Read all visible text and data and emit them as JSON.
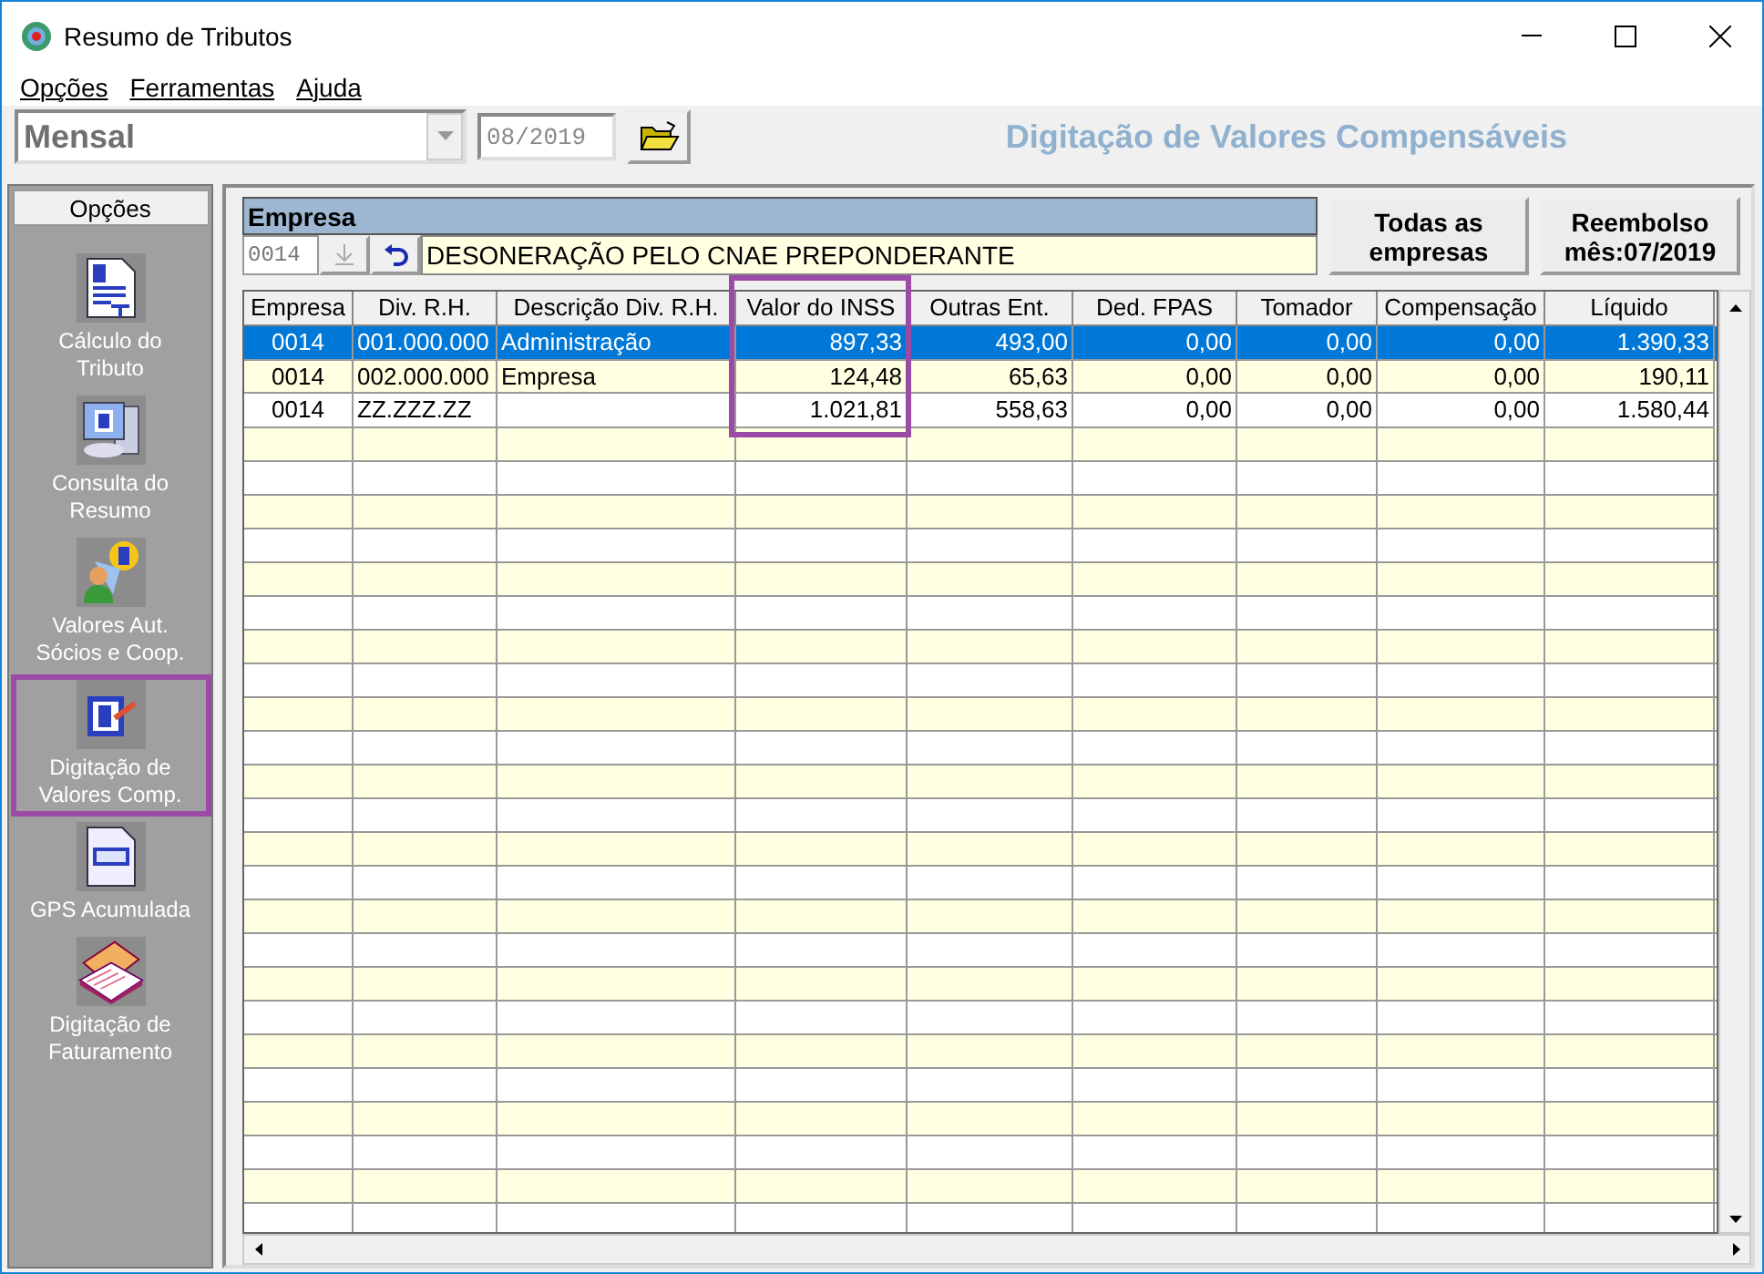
{
  "window": {
    "title": "Resumo de Tributos"
  },
  "menu": [
    {
      "label": "Opções"
    },
    {
      "label": "Ferramentas"
    },
    {
      "label": "Ajuda"
    }
  ],
  "toolbar": {
    "period": "Mensal",
    "date": "08/2019",
    "heading": "Digitação de Valores Compensáveis"
  },
  "sidebar": {
    "header": "Opções",
    "items": [
      {
        "label": "Cálculo do Tributo",
        "kind": "document",
        "highlighted": false
      },
      {
        "label": "Consulta do Resumo",
        "kind": "computer",
        "highlighted": false
      },
      {
        "label": "Valores Aut. Sócios e  Coop.",
        "kind": "people",
        "highlighted": false
      },
      {
        "label": "Digitação de Valores Comp.",
        "kind": "edit",
        "highlighted": true
      },
      {
        "label": "GPS Acumulada",
        "kind": "gps",
        "highlighted": false
      },
      {
        "label": "Digitação de Faturamento",
        "kind": "book",
        "highlighted": false
      }
    ]
  },
  "empresa": {
    "title": "Empresa",
    "code": "0014",
    "description": "DESONERAÇÃO PELO CNAE PREPONDERANTE"
  },
  "buttons": [
    "Todas as empresas",
    "Reembolso mês:07/2019"
  ],
  "table": {
    "columns": [
      {
        "label": "Empresa",
        "highlighted": false
      },
      {
        "label": "Div. R.H.",
        "highlighted": false
      },
      {
        "label": "Descrição Div. R.H.",
        "highlighted": false
      },
      {
        "label": "Valor do INSS",
        "highlighted": true
      },
      {
        "label": "Outras Ent.",
        "highlighted": false
      },
      {
        "label": "Ded. FPAS",
        "highlighted": false
      },
      {
        "label": "Tomador",
        "highlighted": false
      },
      {
        "label": "Compensação",
        "highlighted": false
      },
      {
        "label": "Líquido",
        "highlighted": false
      }
    ],
    "rows": [
      {
        "selected": true,
        "cells": [
          "0014",
          "001.000.000",
          "Administração",
          "897,33",
          "493,00",
          "0,00",
          "0,00",
          "0,00",
          "1.390,33"
        ]
      },
      {
        "selected": false,
        "cells": [
          "0014",
          "002.000.000",
          "Empresa",
          "124,48",
          "65,63",
          "0,00",
          "0,00",
          "0,00",
          "190,11"
        ]
      },
      {
        "selected": false,
        "cells": [
          "0014",
          "ZZ.ZZZ.ZZ",
          "",
          "1.021,81",
          "558,63",
          "0,00",
          "0,00",
          "0,00",
          "1.580,44"
        ]
      }
    ]
  }
}
